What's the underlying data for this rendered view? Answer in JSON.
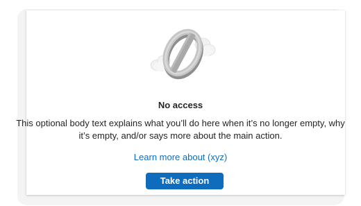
{
  "empty_state": {
    "illustration_icon": "no-access-icon",
    "title": "No access",
    "body": "This optional body text explains what you’ll do here when it’s no longer empty, why it’s empty, and/or says more about the main action.",
    "link_label": "Learn more about (xyz)",
    "action_label": "Take action"
  },
  "colors": {
    "accent": "#0f6cbd",
    "text": "#242424",
    "frame_background": "#f4f4f4",
    "card_background": "#ffffff"
  }
}
